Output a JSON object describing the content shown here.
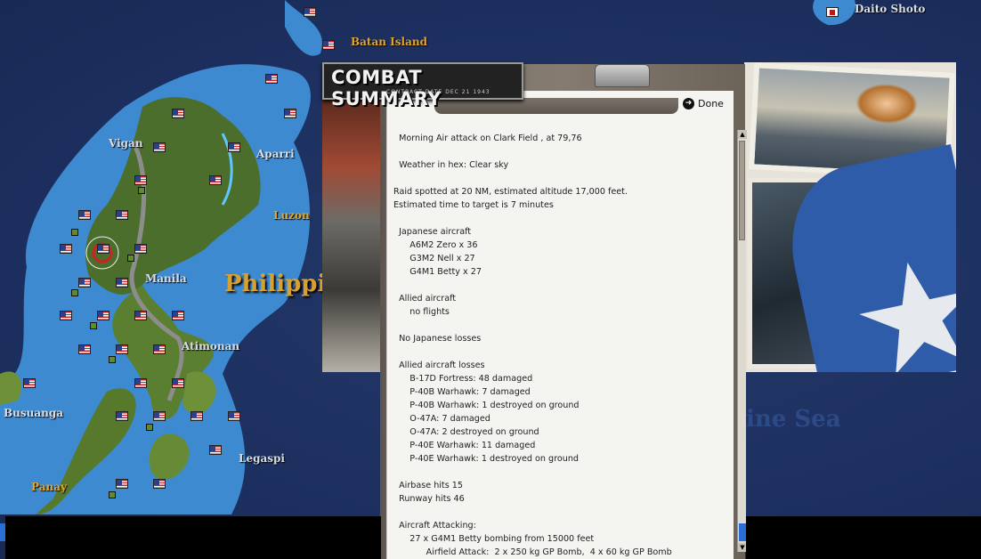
{
  "map": {
    "labels": {
      "daito": "Daito Shoto",
      "batan": "Batan Island",
      "vigan": "Vigan",
      "aparri": "Aparri",
      "luzon": "Luzon",
      "manila": "Manila",
      "philippines": "Philippi",
      "atimonan": "Atimonan",
      "busuanga": "Busuanga",
      "legaspi": "Legaspi",
      "panay": "Panay",
      "sea": "ine Sea"
    }
  },
  "dialog": {
    "title": "COMBAT SUMMARY",
    "subtitle": "CONTRACT DATE DEC 21 1943",
    "done_label": "Done",
    "report_lines": [
      "  Morning Air attack on Clark Field , at 79,76",
      "",
      "  Weather in hex: Clear sky",
      "",
      "Raid spotted at 20 NM, estimated altitude 17,000 feet.",
      "Estimated time to target is 7 minutes",
      "",
      "  Japanese aircraft",
      "      A6M2 Zero x 36",
      "      G3M2 Nell x 27",
      "      G4M1 Betty x 27",
      "",
      "  Allied aircraft",
      "      no flights",
      "",
      "  No Japanese losses",
      "",
      "  Allied aircraft losses",
      "      B-17D Fortress: 48 damaged",
      "      P-40B Warhawk: 7 damaged",
      "      P-40B Warhawk: 1 destroyed on ground",
      "      O-47A: 7 damaged",
      "      O-47A: 2 destroyed on ground",
      "      P-40E Warhawk: 11 damaged",
      "      P-40E Warhawk: 1 destroyed on ground",
      "",
      "  Airbase hits 15",
      "  Runway hits 46",
      "",
      "  Aircraft Attacking:",
      "      27 x G4M1 Betty bombing from 15000 feet",
      "            Airfield Attack:  2 x 250 kg GP Bomb,  4 x 60 kg GP Bomb"
    ]
  }
}
